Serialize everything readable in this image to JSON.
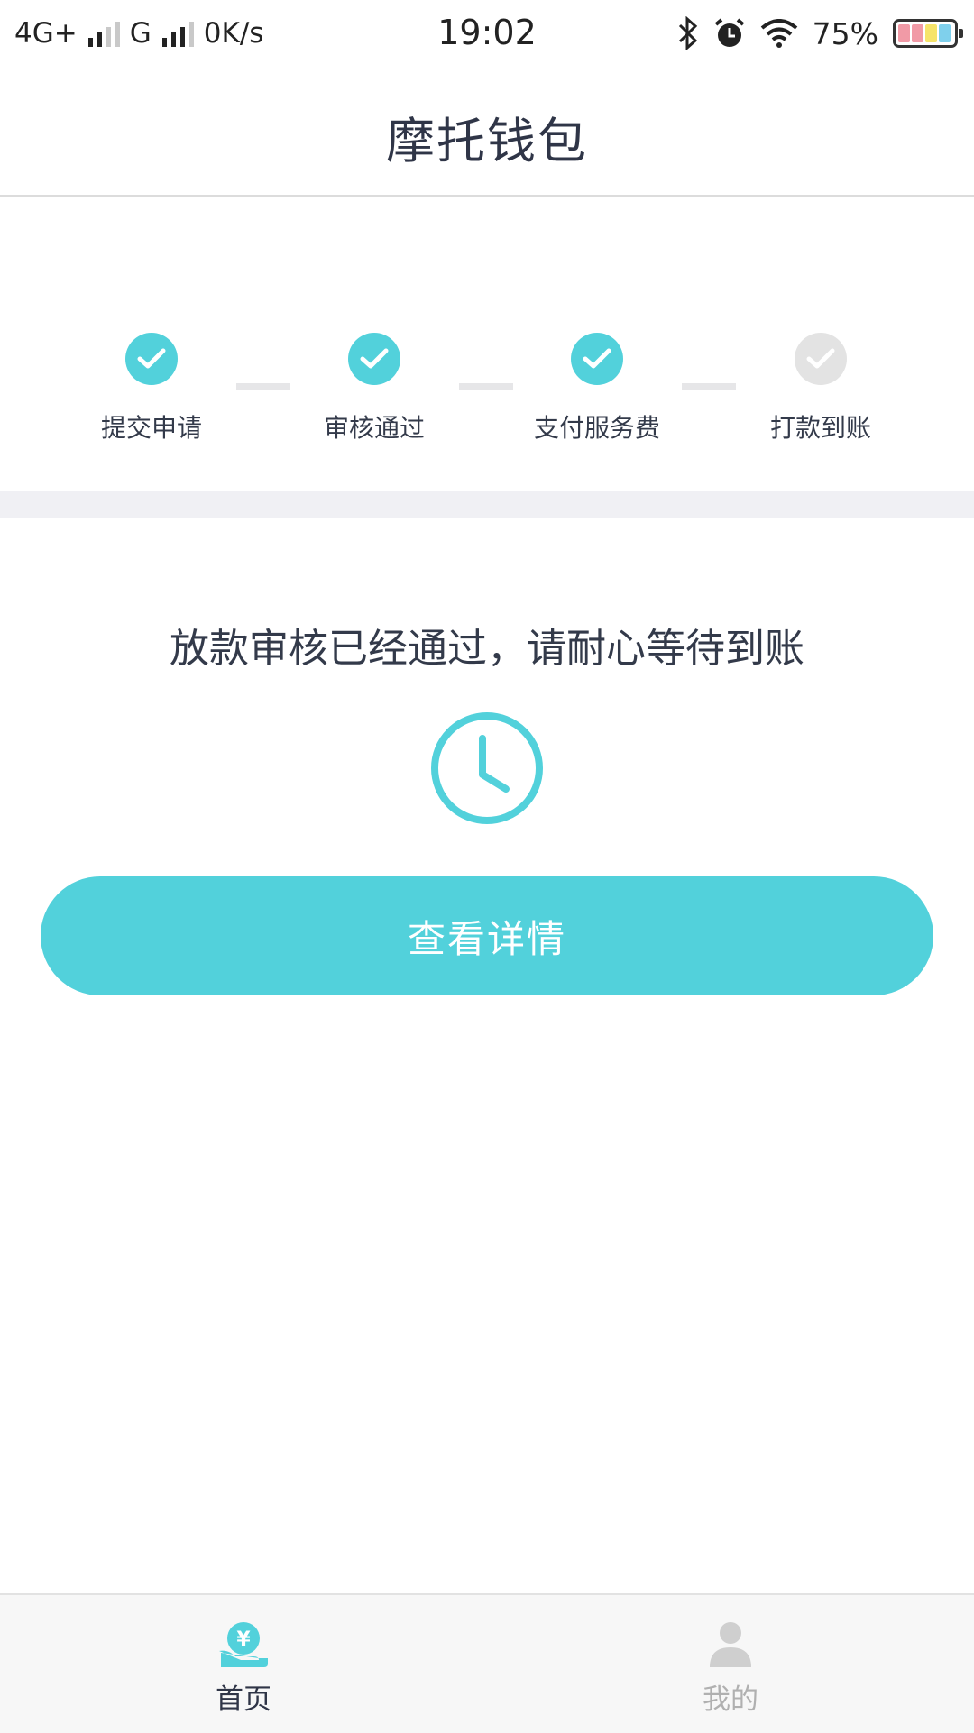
{
  "status_bar": {
    "network1": "4G+",
    "network2": "G",
    "speed": "0K/s",
    "time": "19:02",
    "battery": "75%"
  },
  "header": {
    "title": "摩托钱包"
  },
  "progress": {
    "steps": [
      {
        "label": "提交申请",
        "done": true
      },
      {
        "label": "审核通过",
        "done": true
      },
      {
        "label": "支付服务费",
        "done": true
      },
      {
        "label": "打款到账",
        "done": false
      }
    ]
  },
  "main": {
    "message": "放款审核已经通过，请耐心等待到账",
    "detail_button": "查看详情"
  },
  "tabs": [
    {
      "label": "首页",
      "active": true
    },
    {
      "label": "我的",
      "active": false
    }
  ],
  "colors": {
    "accent": "#52d1db",
    "inactive": "#e3e3e3",
    "text": "#333a4a"
  }
}
